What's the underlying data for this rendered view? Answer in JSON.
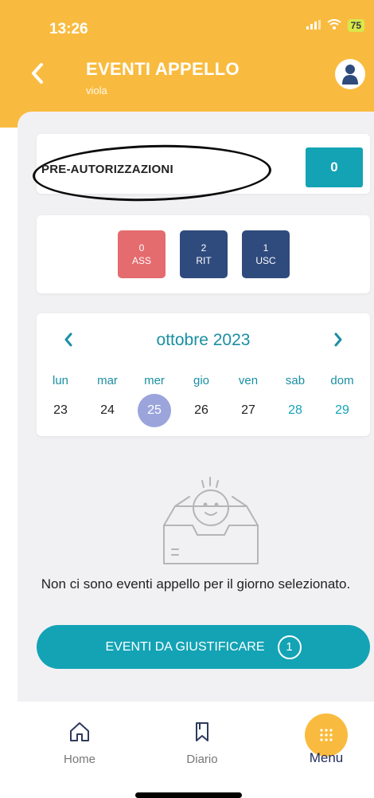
{
  "status_bar": {
    "time": "13:26",
    "battery": "75"
  },
  "header": {
    "title": "EVENTI APPELLO",
    "subtitle": "viola"
  },
  "preauth": {
    "label": "PRE-AUTORIZZAZIONI",
    "count": "0"
  },
  "badges": [
    {
      "value": "0",
      "label": "ASS",
      "color": "#e46b6e"
    },
    {
      "value": "2",
      "label": "RIT",
      "color": "#2f4a7d"
    },
    {
      "value": "1",
      "label": "USC",
      "color": "#2f4a7d"
    }
  ],
  "calendar": {
    "month": "ottobre 2023",
    "weekdays": [
      "lun",
      "mar",
      "mer",
      "gio",
      "ven",
      "sab",
      "dom"
    ],
    "days": [
      "23",
      "24",
      "25",
      "26",
      "27",
      "28",
      "29"
    ],
    "selected_day": "25"
  },
  "empty_state": {
    "message": "Non ci sono eventi appello per il giorno selezionato."
  },
  "justify_button": {
    "label": "EVENTI DA GIUSTIFICARE",
    "count": "1"
  },
  "tabbar": {
    "home": "Home",
    "diario": "Diario",
    "menu": "Menu",
    "active": "Menu"
  },
  "colors": {
    "accent": "#f9bb3f",
    "teal": "#13a3b5",
    "navy": "#2f4a7d",
    "red": "#e46b6e",
    "selected": "#9ba5dc"
  }
}
